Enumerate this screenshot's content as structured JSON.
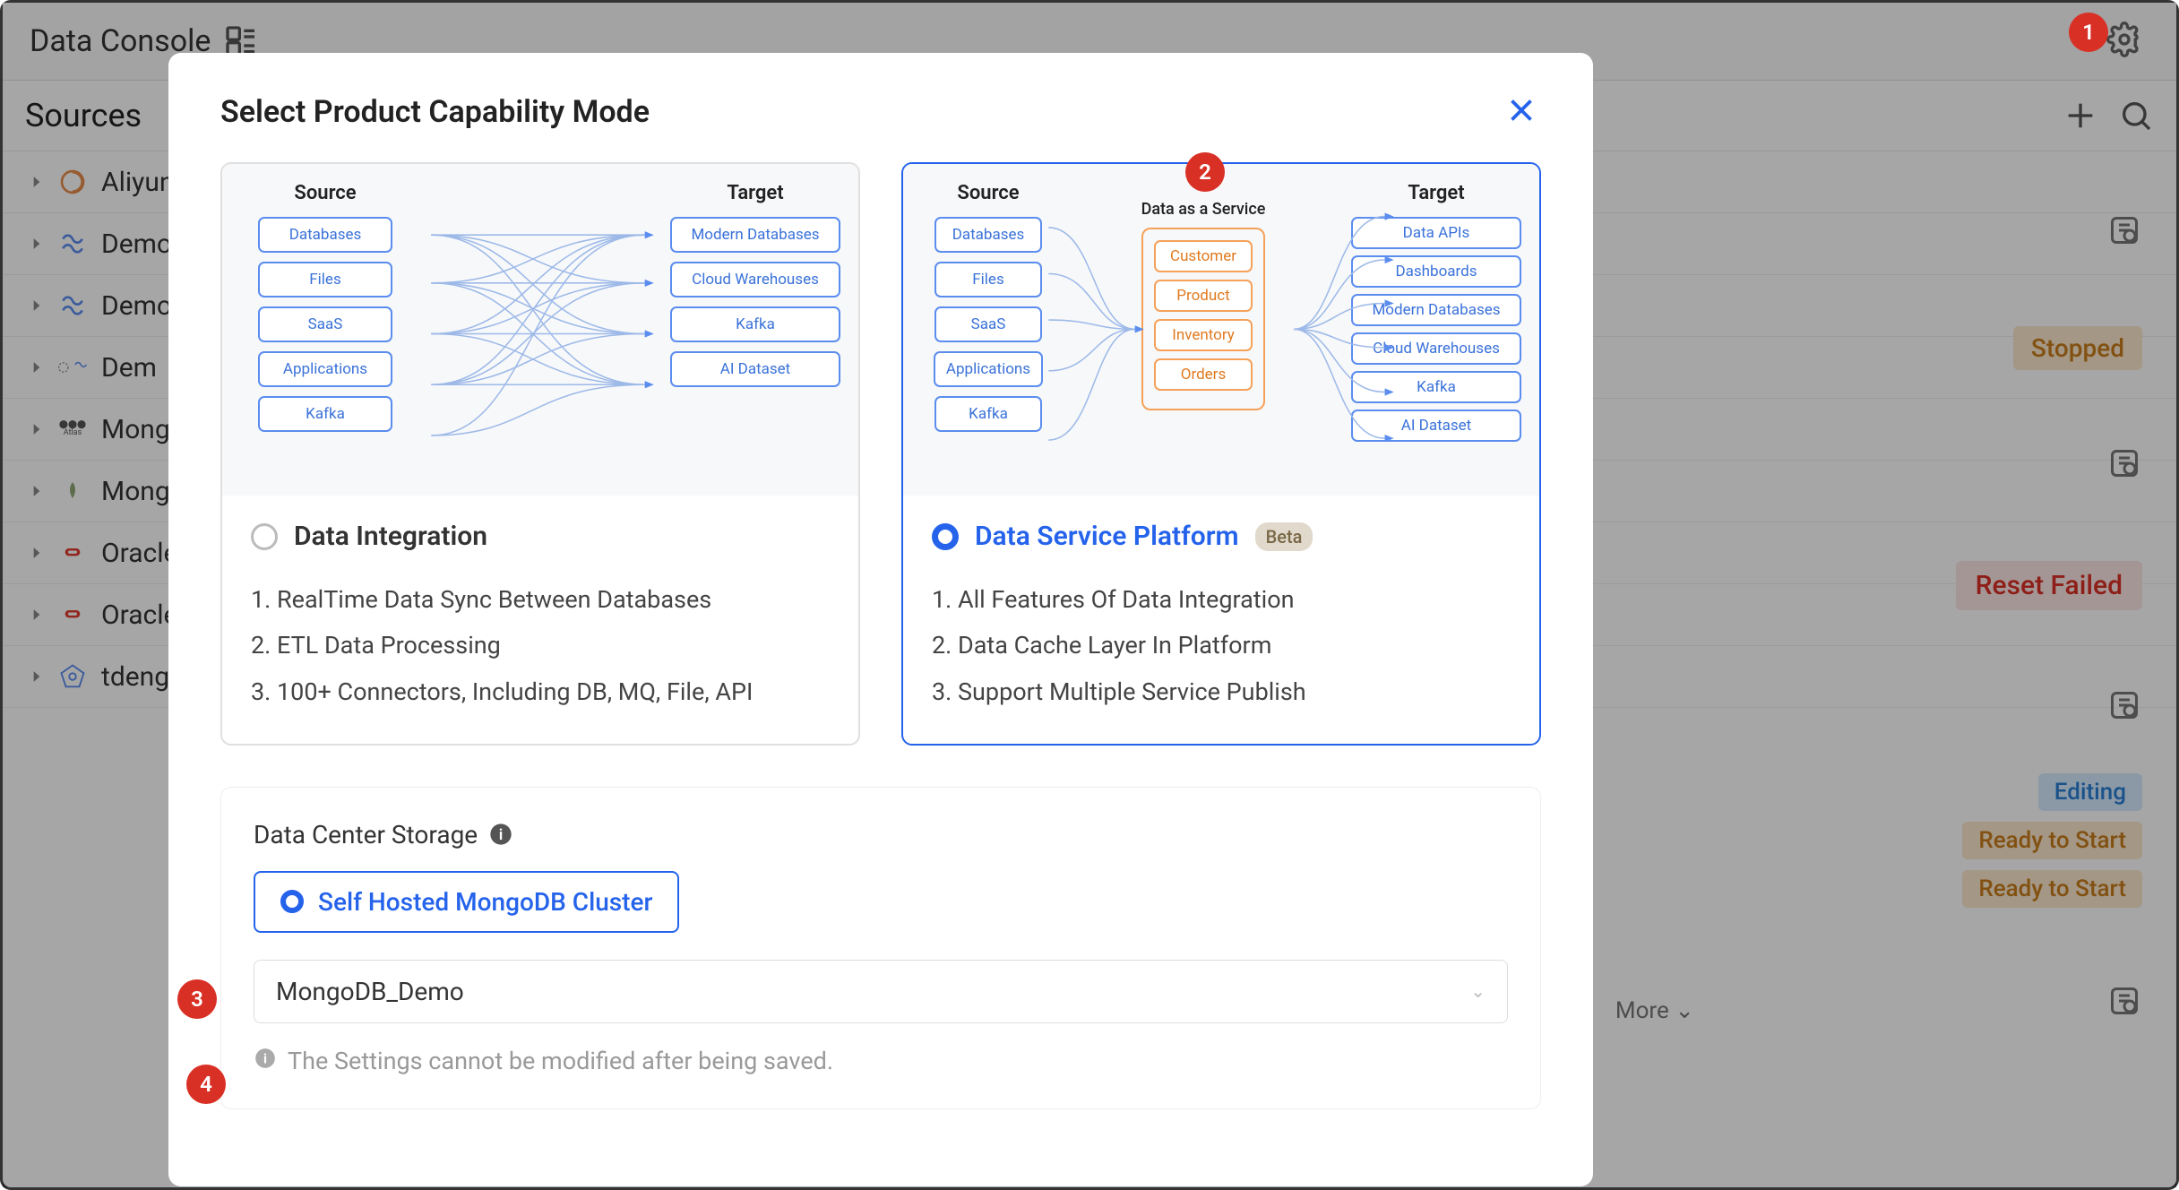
{
  "header": {
    "app_title": "Data Console"
  },
  "sources": {
    "title": "Sources",
    "items": [
      {
        "name": "Aliyun_"
      },
      {
        "name": "Demo_"
      },
      {
        "name": "Demo_"
      },
      {
        "name": "Dem"
      },
      {
        "name": "Mongo"
      },
      {
        "name": "Mongo"
      },
      {
        "name": "Oracle"
      },
      {
        "name": "Oracle"
      },
      {
        "name": "tdengi"
      }
    ]
  },
  "statuses": {
    "stopped": "Stopped",
    "reset_failed": "Reset Failed",
    "editing": "Editing",
    "ready": "Ready to Start"
  },
  "load_more": "More",
  "modal": {
    "title": "Select Product Capability Mode",
    "card_left": {
      "name": "Data Integration",
      "source_label": "Source",
      "target_label": "Target",
      "sources": [
        "Databases",
        "Files",
        "SaaS",
        "Applications",
        "Kafka"
      ],
      "targets": [
        "Modern Databases",
        "Cloud Warehouses",
        "Kafka",
        "AI Dataset"
      ],
      "features": [
        "1. RealTime Data Sync Between Databases",
        "2. ETL Data Processing",
        "3. 100+ Connectors, Including DB, MQ, File, API"
      ]
    },
    "card_right": {
      "name": "Data Service Platform",
      "badge": "Beta",
      "source_label": "Source",
      "target_label": "Target",
      "service_label": "Data as a Service",
      "sources": [
        "Databases",
        "Files",
        "SaaS",
        "Applications",
        "Kafka"
      ],
      "services": [
        "Customer",
        "Product",
        "Inventory",
        "Orders"
      ],
      "targets": [
        "Data APIs",
        "Dashboards",
        "Modern Databases",
        "Cloud Warehouses",
        "Kafka",
        "AI Dataset"
      ],
      "features": [
        "1. All Features Of Data Integration",
        "2. Data Cache Layer In Platform",
        "3. Support Multiple Service Publish"
      ]
    },
    "storage": {
      "title": "Data Center Storage",
      "option": "Self Hosted MongoDB Cluster",
      "select_value": "MongoDB_Demo",
      "note": "The Settings cannot be modified after being saved."
    }
  },
  "badges": {
    "b1": "1",
    "b2": "2",
    "b3": "3",
    "b4": "4"
  }
}
